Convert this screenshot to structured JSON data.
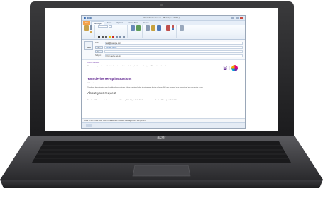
{
  "window": {
    "title": "Your device set-up - Message (HTML)"
  },
  "tabs": [
    {
      "label": "File"
    },
    {
      "label": "Message"
    },
    {
      "label": "Insert"
    },
    {
      "label": "Options"
    },
    {
      "label": "Format Text"
    },
    {
      "label": "Review"
    }
  ],
  "header": {
    "send_label": "Send",
    "from_label": "From",
    "from_value": "ask@example.com",
    "to_label": "To...",
    "to_value": "Contact Name",
    "cc_label": "Cc...",
    "subject_label": "Subject:",
    "subject_value": "Your device set-up"
  },
  "email": {
    "top_link": "View in a browser",
    "intro": "This email may contain confidential information and is intended only for the named recipient. Please do not forward.",
    "brand": "BT",
    "heading": "Your device set-up instructions",
    "greeting": "Hello and...",
    "body": "Thank you for contacting your broadband service team. Follow the steps below to set up your device at home. We have received your request and are processing it now.",
    "section_title": "About your request",
    "info_left": "Broadband Plus - connected",
    "info_mid": "Saturday 27th July at 10:00 2017",
    "info_right": "Sunday 28th July at 09:00 2017"
  },
  "infobar": {
    "text": "Click or tap to see other recent updates and received messages from this person."
  },
  "laptop": {
    "brand": "acer"
  }
}
